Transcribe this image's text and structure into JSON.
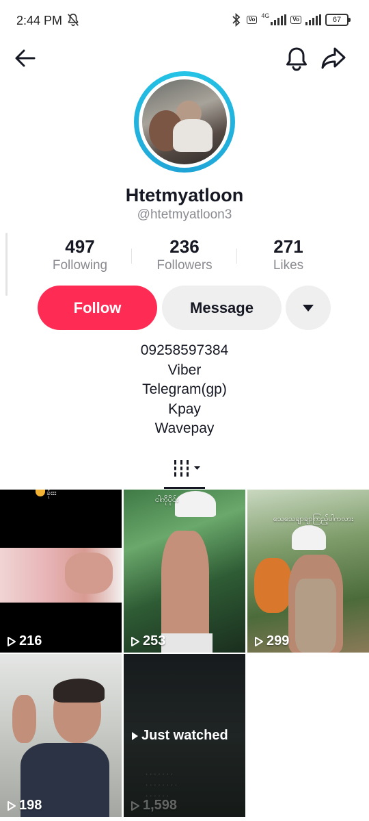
{
  "status_bar": {
    "time": "2:44 PM",
    "network": "4G",
    "lte_label_1": "Vo\nLTE",
    "lte_label_2": "Vo\nLTE",
    "battery": "67"
  },
  "nav": {
    "back_icon": "arrow-left-icon",
    "bell_icon": "bell-icon",
    "share_icon": "share-arrow-icon"
  },
  "profile": {
    "display_name": "Htetmyatloon",
    "username": "@htetmyatloon3",
    "ring_color": "#25c4e6"
  },
  "stats": [
    {
      "value": "497",
      "label": "Following"
    },
    {
      "value": "236",
      "label": "Followers"
    },
    {
      "value": "271",
      "label": "Likes"
    }
  ],
  "actions": {
    "follow_label": "Follow",
    "message_label": "Message",
    "follow_color": "#fe2c55"
  },
  "bio": [
    "09258597384",
    "Viber",
    "Telegram(gp)",
    "Kpay",
    "Wavepay"
  ],
  "tabs": {
    "videos_icon": "grid-columns-icon"
  },
  "videos": [
    {
      "views": "216",
      "caption": "ခုံးးး"
    },
    {
      "views": "253",
      "caption": "ငါကိုပိုင်း"
    },
    {
      "views": "299",
      "caption": "သေသေချာချာကြည့်ပါကလား"
    },
    {
      "views": "198"
    },
    {
      "views": "1,598",
      "overlay_label": "Just watched"
    }
  ]
}
